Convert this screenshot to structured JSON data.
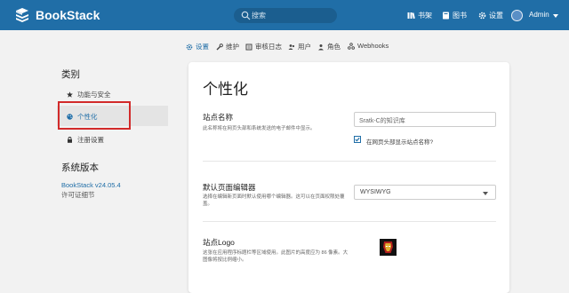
{
  "header": {
    "brand": "BookStack",
    "search_placeholder": "搜索",
    "nav": [
      {
        "label": "书架",
        "icon": "bookshelf-icon"
      },
      {
        "label": "图书",
        "icon": "book-icon"
      },
      {
        "label": "设置",
        "icon": "gear-icon"
      }
    ],
    "user": "Admin"
  },
  "tabs": [
    {
      "label": "设置",
      "icon": "gear-icon",
      "active": true
    },
    {
      "label": "维护",
      "icon": "wrench-icon"
    },
    {
      "label": "审核日志",
      "icon": "audit-icon"
    },
    {
      "label": "用户",
      "icon": "users-icon"
    },
    {
      "label": "角色",
      "icon": "role-icon"
    },
    {
      "label": "Webhooks",
      "icon": "webhook-icon"
    }
  ],
  "sidebar": {
    "category_heading": "类别",
    "items": [
      {
        "label": "功能与安全",
        "icon": "star-icon"
      },
      {
        "label": "个性化",
        "icon": "palette-icon",
        "active": true
      },
      {
        "label": "注册设置",
        "icon": "lock-icon"
      }
    ],
    "version_heading": "系统版本",
    "version": "BookStack v24.05.4",
    "license": "许可证细节"
  },
  "main": {
    "title": "个性化",
    "site_name": {
      "label": "站点名称",
      "desc": "此名称将在网页头部和系统发送的电子邮件中显示。",
      "value": "Sratk-C的知识库",
      "checkbox_label": "在网页头部显示站点名称?",
      "checked": true
    },
    "editor": {
      "label": "默认页面编辑器",
      "desc": "选择在编辑新页面时默认使用哪个编辑器。这可以在页面权限处覆盖。",
      "value": "WYSIWYG"
    },
    "logo": {
      "label": "站点Logo",
      "desc": "这张在应用程序标题栏等区域使用。此图片的高度应为 86 像素。大图像将按比例缩小。"
    }
  },
  "colors": {
    "header_bg": "#206ea7",
    "accent": "#206ea7",
    "highlight": "#d22a2a"
  }
}
